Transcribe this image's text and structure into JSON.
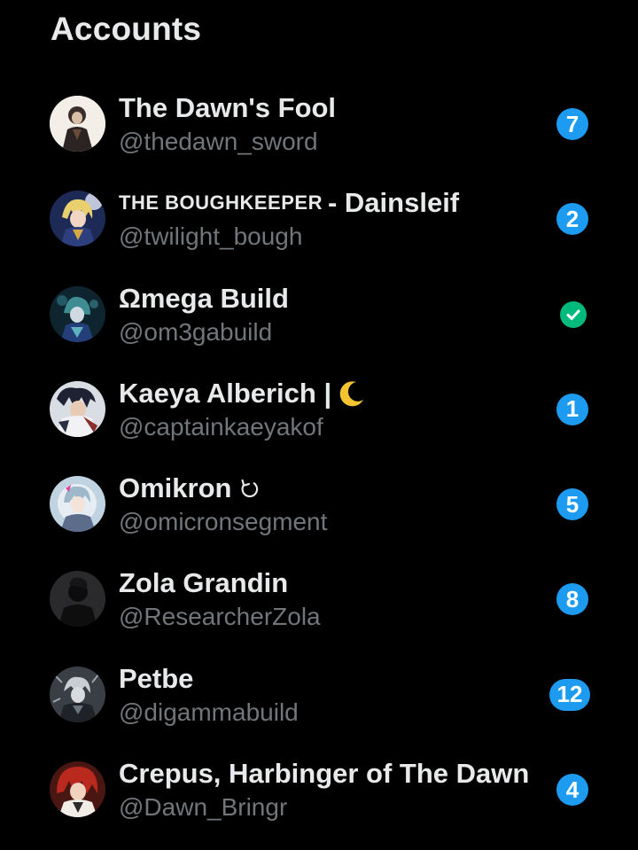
{
  "header": {
    "title": "Accounts"
  },
  "colors": {
    "background": "#000000",
    "primary_text": "#e7e9ea",
    "secondary_text": "#71767b",
    "badge_blue": "#1d9bf0",
    "badge_green": "#00ba7c"
  },
  "accounts": [
    {
      "name": "The Dawn's Fool",
      "handle": "@thedawn_sword",
      "badge": "7",
      "avatar_icon": "avatar-dark-figure"
    },
    {
      "name_caps": "THE BOUGHKEEPER",
      "name_rest": "- Dainsleif",
      "handle": "@twilight_bough",
      "badge": "2",
      "avatar_icon": "avatar-blonde-figure"
    },
    {
      "name": "Ωmega Build",
      "handle": "@om3gabuild",
      "badge_icon": "check-icon",
      "avatar_icon": "avatar-teal-figure"
    },
    {
      "name": "Kaeya Alberich |",
      "name_emoji": "crescent-moon-icon",
      "handle": "@captainkaeyakof",
      "badge": "1",
      "avatar_icon": "avatar-dark-hair-figure"
    },
    {
      "name": "Omikron",
      "name_emoji": "refresh-arrow-icon",
      "handle": "@omicronsegment",
      "badge": "5",
      "avatar_icon": "avatar-anime-figure"
    },
    {
      "name": "Zola Grandin",
      "handle": "@ResearcherZola",
      "badge": "8",
      "avatar_icon": "avatar-silhouette"
    },
    {
      "name": "Petbe",
      "handle": "@digammabuild",
      "badge": "12",
      "avatar_icon": "avatar-grey-figure"
    },
    {
      "name": "Crepus, Harbinger of The Dawn",
      "handle": "@Dawn_Bringr",
      "badge": "4",
      "avatar_icon": "avatar-red-hair-figure"
    }
  ]
}
